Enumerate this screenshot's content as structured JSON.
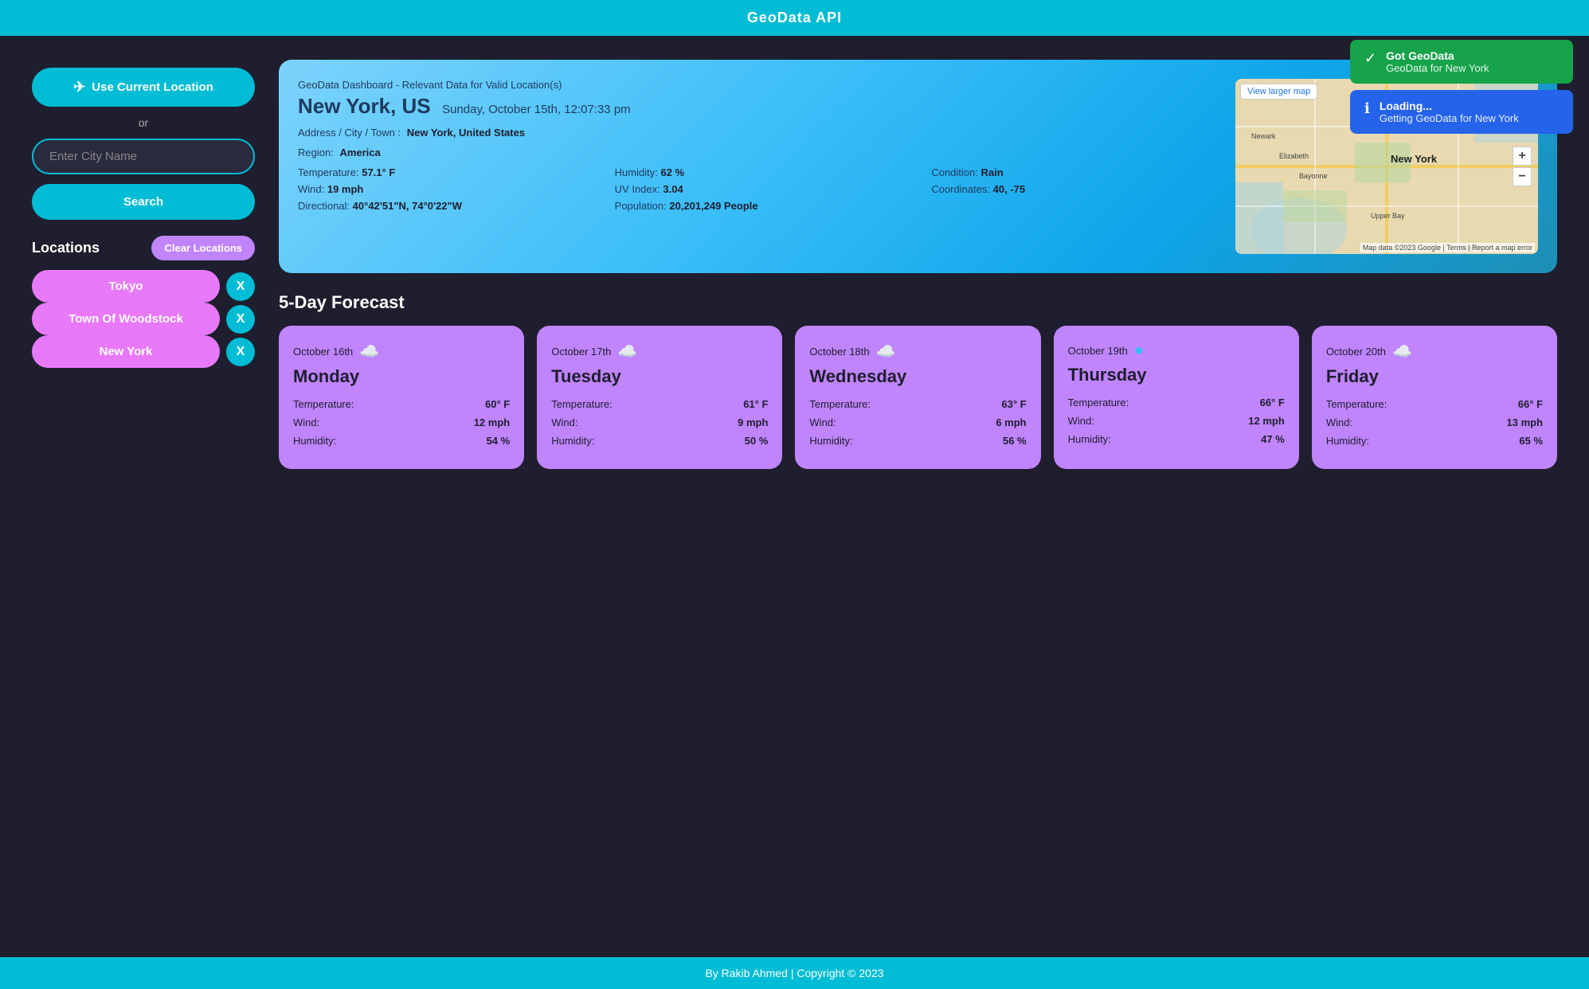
{
  "header": {
    "title": "GeoData API"
  },
  "footer": {
    "text": "By Rakib Ahmed | Copyright © 2023"
  },
  "sidebar": {
    "use_current_location_label": "Use Current Location",
    "or_text": "or",
    "city_input_placeholder": "Enter City Name",
    "search_label": "Search",
    "locations_title": "Locations",
    "clear_locations_label": "Clear Locations",
    "locations": [
      {
        "name": "Tokyo",
        "id": "tokyo"
      },
      {
        "name": "Town Of Woodstock",
        "id": "woodstock"
      },
      {
        "name": "New York",
        "id": "newyork"
      }
    ]
  },
  "weather": {
    "dashboard_subtitle": "GeoData Dashboard - Relevant Data for Valid Location(s)",
    "city": "New York, US",
    "datetime": "Sunday, October 15th, 12:07:33 pm",
    "address_label": "Address / City / Town :",
    "address_value": "New York, United States",
    "region_label": "Region:",
    "region_value": "America",
    "temperature_label": "Temperature:",
    "temperature_value": "57.1° F",
    "humidity_label": "Humidity:",
    "humidity_value": "62 %",
    "condition_label": "Condition:",
    "condition_value": "Rain",
    "wind_label": "Wind:",
    "wind_value": "19 mph",
    "uv_label": "UV Index:",
    "uv_value": "3.04",
    "coordinates_label": "Coordinates:",
    "coordinates_value": "40, -75",
    "directional_label": "Directional:",
    "directional_value": "40°42'51\"N, 74°0'22\"W",
    "population_label": "Population:",
    "population_value": "20,201,249 People",
    "map_view_larger": "View larger map"
  },
  "forecast": {
    "title": "5-Day Forecast",
    "days": [
      {
        "date": "October 16th",
        "day": "Monday",
        "icon": "cloud",
        "temperature": "60° F",
        "wind": "12 mph",
        "humidity": "54 %"
      },
      {
        "date": "October 17th",
        "day": "Tuesday",
        "icon": "cloud",
        "temperature": "61° F",
        "wind": "9 mph",
        "humidity": "50 %"
      },
      {
        "date": "October 18th",
        "day": "Wednesday",
        "icon": "cloud",
        "temperature": "63° F",
        "wind": "6 mph",
        "humidity": "56 %"
      },
      {
        "date": "October 19th",
        "day": "Thursday",
        "icon": "circle",
        "temperature": "66° F",
        "wind": "12 mph",
        "humidity": "47 %"
      },
      {
        "date": "October 20th",
        "day": "Friday",
        "icon": "cloud",
        "temperature": "66° F",
        "wind": "13 mph",
        "humidity": "65 %"
      }
    ],
    "temp_label": "Temperature:",
    "wind_label": "Wind:",
    "humidity_label": "Humidity:"
  },
  "toasts": [
    {
      "type": "success",
      "title": "Got GeoData",
      "body": "GeoData for New York"
    },
    {
      "type": "info",
      "title": "Loading...",
      "body": "Getting GeoData for New York"
    }
  ]
}
